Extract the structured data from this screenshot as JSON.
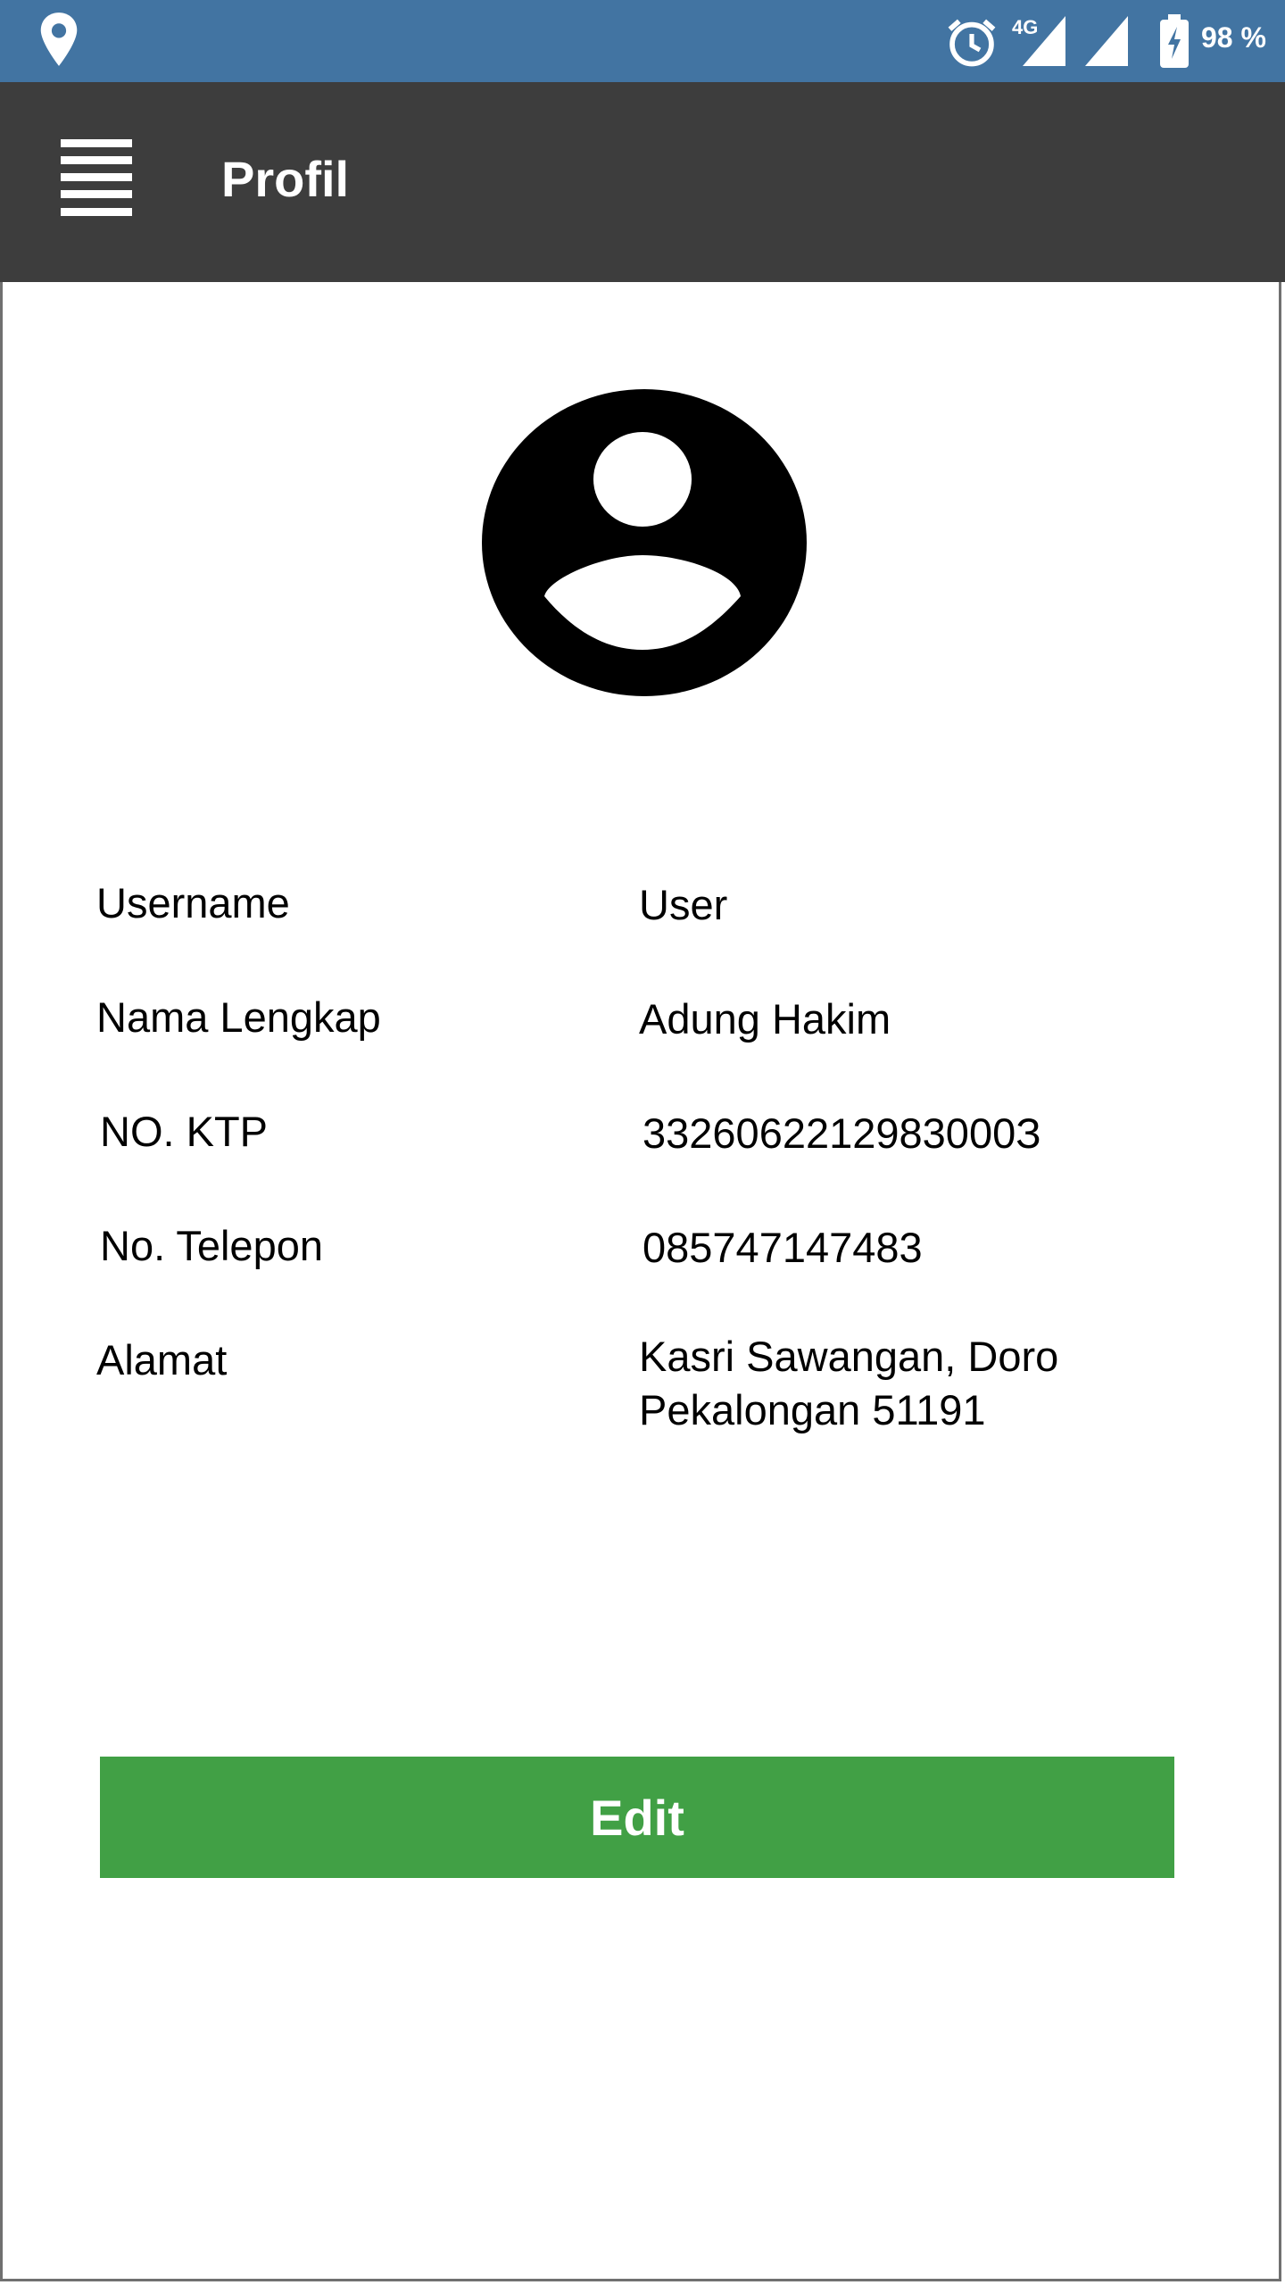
{
  "status_bar": {
    "network": "4G",
    "battery": "98 %",
    "icons": [
      "location-icon",
      "alarm-icon",
      "signal-icon",
      "battery-charging-icon"
    ],
    "background": "#4274a2"
  },
  "app_bar": {
    "title": "Profil",
    "menu_icon": "hamburger-menu-icon",
    "background": "#3d3d3d"
  },
  "profile": {
    "avatar_icon": "account-circle-icon",
    "fields": [
      {
        "label": "Username",
        "value": "User"
      },
      {
        "label": "Nama Lengkap",
        "value": "Adung Hakim"
      },
      {
        "label": "NO. KTP",
        "value": "3326062212983000З"
      },
      {
        "label": "No. Telepon",
        "value": "085747147483"
      },
      {
        "label": "Alamat",
        "value_line1": "Kasri Sawangan, Doro",
        "value_line2": "Pekalongan 51191"
      }
    ]
  },
  "actions": {
    "edit_label": "Edit",
    "edit_color": "#41a045"
  }
}
